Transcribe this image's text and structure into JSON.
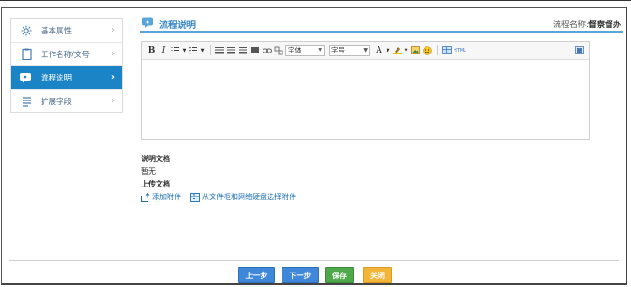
{
  "sidebar": {
    "items": [
      {
        "label": "基本属性",
        "icon": "gear-icon",
        "active": false
      },
      {
        "label": "工作名称/文号",
        "icon": "clipboard-icon",
        "active": false
      },
      {
        "label": "流程说明",
        "icon": "info-bubble-icon",
        "active": true
      },
      {
        "label": "扩展字段",
        "icon": "list-icon",
        "active": false
      }
    ]
  },
  "header": {
    "title": "流程说明",
    "name_label": "流程名称:",
    "name_value": "督察督办"
  },
  "editor": {
    "font_select": "字体",
    "size_select": "字号",
    "font_color_label": "A",
    "html_label": "HTML"
  },
  "info": {
    "desc_doc_label": "说明文档",
    "desc_doc_value": "暂无",
    "upload_label": "上传文档"
  },
  "links": {
    "add_attachment": "添加附件",
    "select_from_cabinet": "从文件柜和网络硬盘选择附件"
  },
  "buttons": {
    "prev": "上一步",
    "next": "下一步",
    "save": "保存",
    "close": "关闭"
  },
  "colors": {
    "accent": "#1a84c6",
    "primary_button": "#3f87d8",
    "save_button": "#4fa84a",
    "close_button": "#f3b43a"
  }
}
